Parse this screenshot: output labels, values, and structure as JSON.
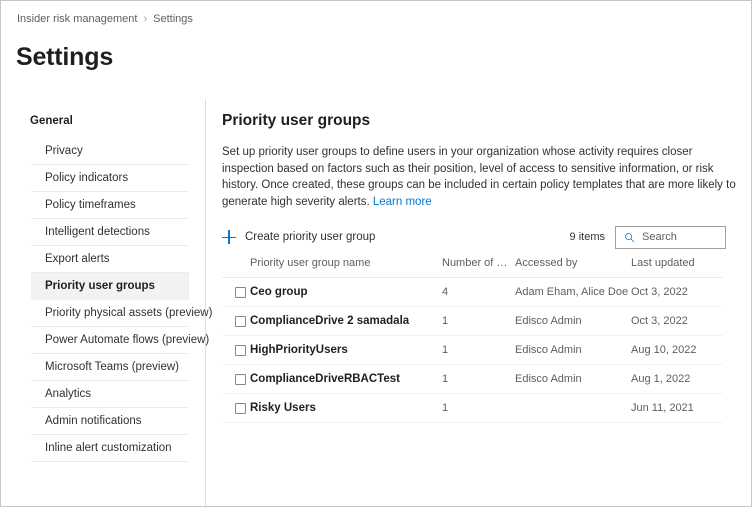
{
  "breadcrumb": {
    "items": [
      "Insider risk management",
      "Settings"
    ],
    "separator": "›"
  },
  "page_title": "Settings",
  "sidebar": {
    "heading": "General",
    "items": [
      {
        "label": "Privacy",
        "selected": false
      },
      {
        "label": "Policy indicators",
        "selected": false
      },
      {
        "label": "Policy timeframes",
        "selected": false
      },
      {
        "label": "Intelligent detections",
        "selected": false
      },
      {
        "label": "Export alerts",
        "selected": false
      },
      {
        "label": "Priority user groups",
        "selected": true
      },
      {
        "label": "Priority physical assets (preview)",
        "selected": false
      },
      {
        "label": "Power Automate flows (preview)",
        "selected": false
      },
      {
        "label": "Microsoft Teams (preview)",
        "selected": false
      },
      {
        "label": "Analytics",
        "selected": false
      },
      {
        "label": "Admin notifications",
        "selected": false
      },
      {
        "label": "Inline alert customization",
        "selected": false
      }
    ]
  },
  "main": {
    "title": "Priority user groups",
    "description": "Set up priority user groups to define users in your organization whose activity requires closer inspection based on factors such as their position, level of access to sensitive information, or risk history. Once created, these groups can be included in certain policy templates that are more likely to generate high severity alerts.",
    "learn_more": "Learn more",
    "toolbar": {
      "create_label": "Create priority user group",
      "items_count": "9 items",
      "search_placeholder": "Search",
      "search_value": ""
    },
    "table": {
      "columns": [
        "Priority user group name",
        "Number of memb...",
        "Accessed by",
        "Last updated"
      ],
      "rows": [
        {
          "name": "Ceo group",
          "members": "4",
          "accessed_by": "Adam Eham, Alice Doe",
          "last_updated": "Oct 3, 2022"
        },
        {
          "name": "ComplianceDrive 2 samadala",
          "members": "1",
          "accessed_by": "Edisco Admin",
          "last_updated": "Oct 3, 2022"
        },
        {
          "name": "HighPriorityUsers",
          "members": "1",
          "accessed_by": "Edisco Admin",
          "last_updated": "Aug 10, 2022"
        },
        {
          "name": "ComplianceDriveRBACTest",
          "members": "1",
          "accessed_by": "Edisco Admin",
          "last_updated": "Aug 1, 2022"
        },
        {
          "name": "Risky Users",
          "members": "1",
          "accessed_by": "",
          "last_updated": "Jun 11, 2021"
        }
      ]
    }
  },
  "colors": {
    "accent": "#0078d4",
    "selected_nav_bg": "#f3f2f1",
    "border": "#e1dfdd"
  }
}
